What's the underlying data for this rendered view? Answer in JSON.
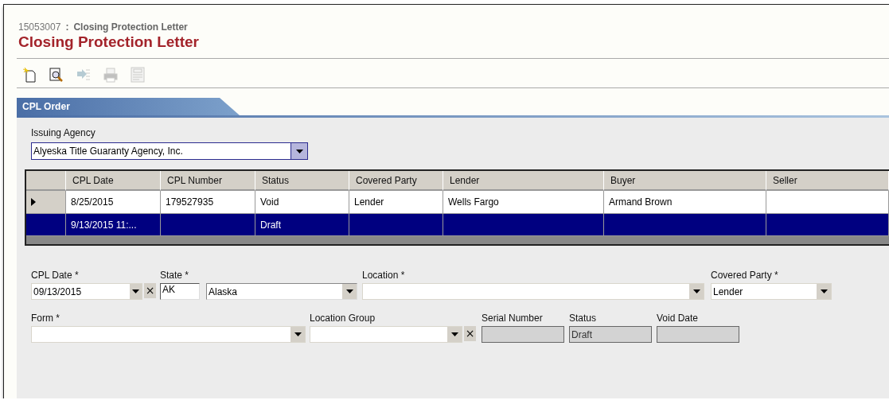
{
  "header": {
    "record_number": "15053007",
    "separator": ":",
    "subtitle": "Closing Protection Letter",
    "title": "Closing Protection Letter"
  },
  "toolbar": [
    {
      "kind": "new",
      "disabled": false
    },
    {
      "kind": "preview",
      "disabled": false
    },
    {
      "kind": "transfer",
      "disabled": true
    },
    {
      "kind": "print",
      "disabled": true
    },
    {
      "kind": "void",
      "disabled": true
    }
  ],
  "tab": {
    "label": "CPL Order"
  },
  "issuing_agency": {
    "label": "Issuing Agency",
    "value": "Alyeska Title Guaranty Agency, Inc."
  },
  "table": {
    "columns": [
      "CPL Date",
      "CPL Number",
      "Status",
      "Covered Party",
      "Lender",
      "Buyer",
      "Seller"
    ],
    "rows": [
      {
        "current": true,
        "selected": false,
        "cells": [
          "8/25/2015",
          "179527935",
          "Void",
          "Lender",
          "Wells Fargo",
          "Armand Brown",
          null
        ]
      },
      {
        "current": false,
        "selected": true,
        "cells": [
          "9/13/2015 11:...",
          null,
          "Draft",
          null,
          null,
          null,
          null
        ]
      }
    ]
  },
  "form_rows": [
    [
      {
        "kind": "date",
        "label": "CPL Date *",
        "value": "09/13/2015",
        "clear": "×"
      },
      {
        "kind": "state",
        "label": "State *",
        "code": "AK",
        "value": "Alaska"
      },
      {
        "kind": "dropdown",
        "label": "Location *"
      },
      {
        "kind": "dropdown",
        "label": "Covered Party *",
        "value": "Lender"
      }
    ],
    [
      {
        "kind": "dropdown",
        "label": "Form *"
      },
      {
        "kind": "dropdown",
        "label": "Location Group",
        "clear": "×"
      },
      {
        "kind": "readonly",
        "label": "Serial Number"
      },
      {
        "kind": "readonly",
        "label": "Status",
        "value": "Draft"
      },
      {
        "kind": "readonly",
        "label": "Void Date"
      }
    ]
  ]
}
